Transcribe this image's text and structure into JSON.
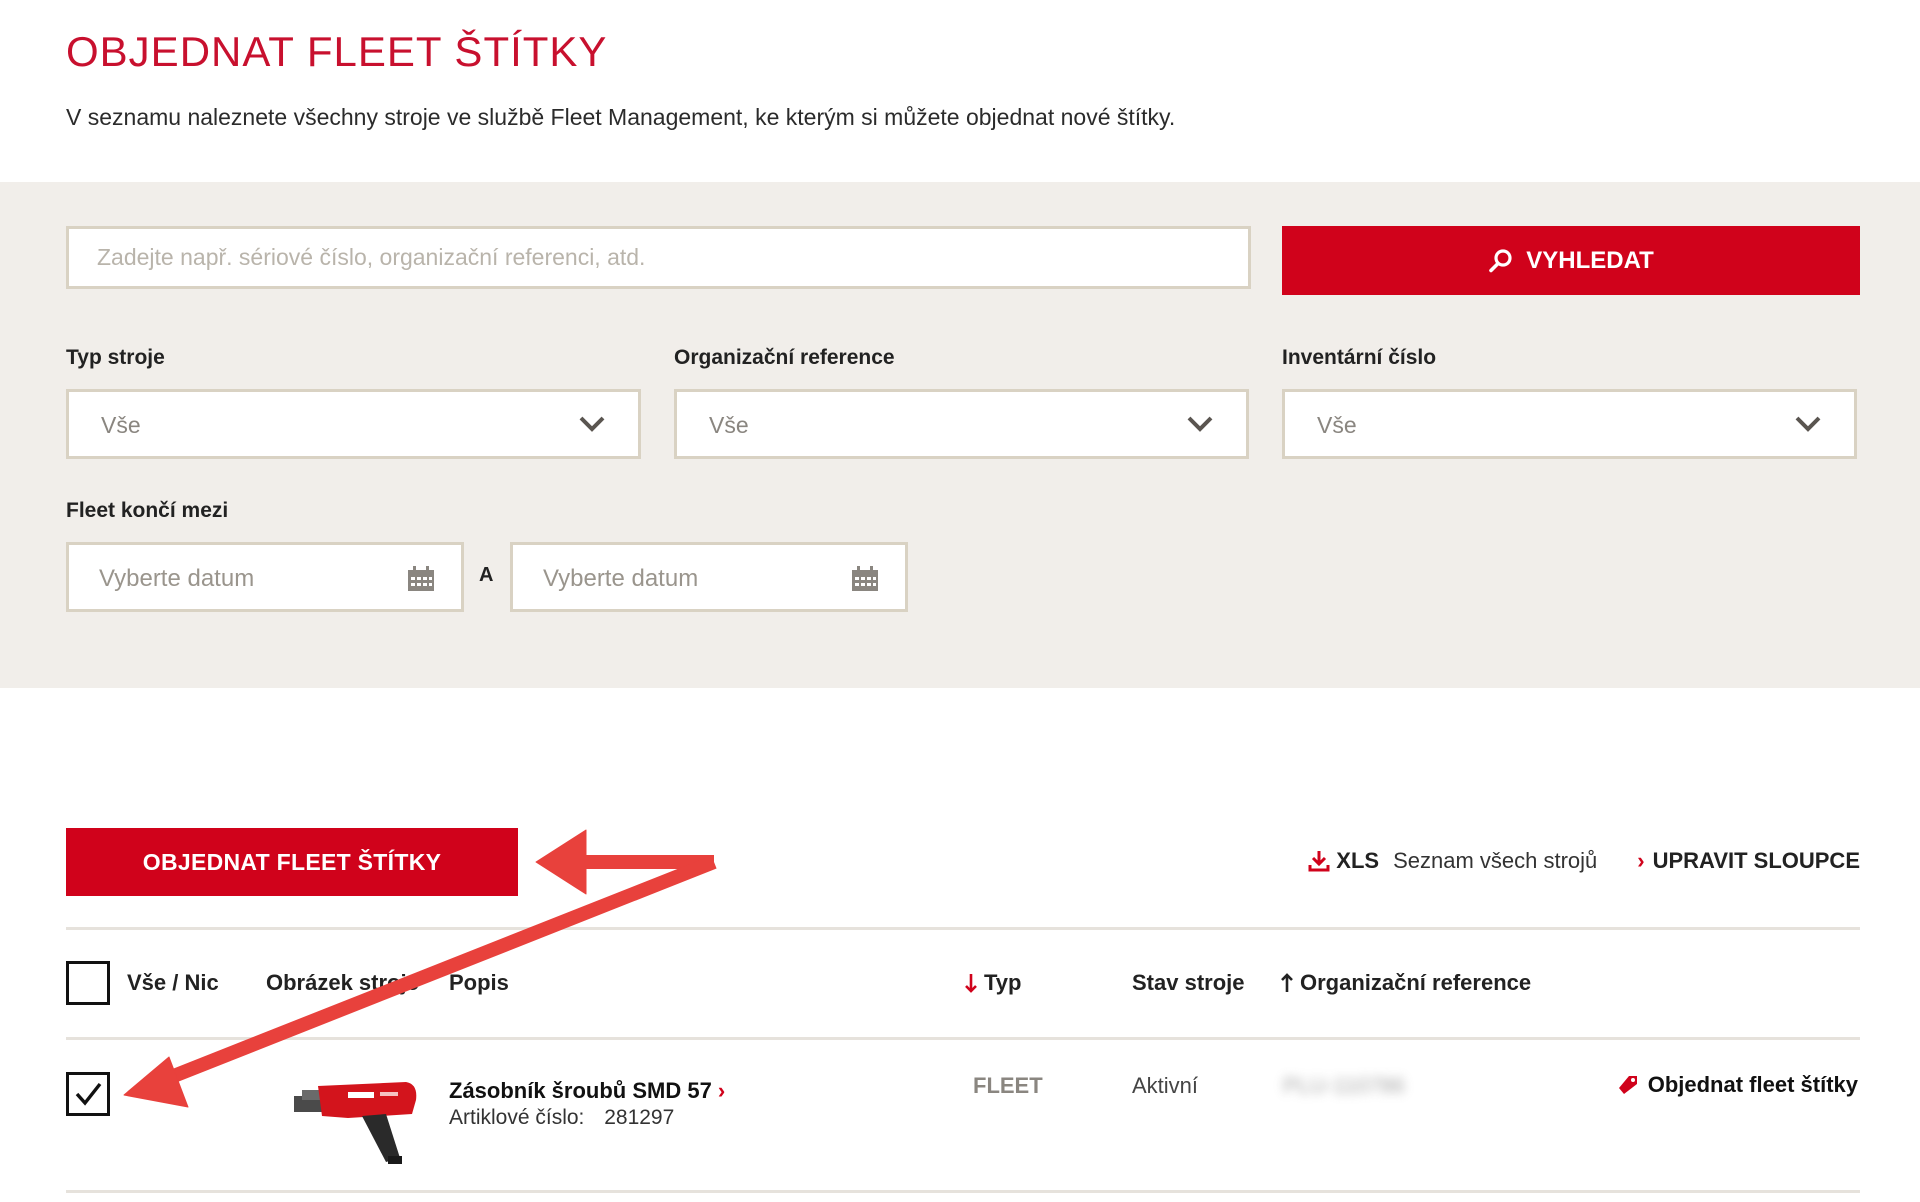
{
  "page": {
    "title": "OBJEDNAT FLEET ŠTÍTKY",
    "intro": "V seznamu naleznete všechny stroje ve službě Fleet Management, ke kterým si můžete objednat nové štítky."
  },
  "search": {
    "placeholder": "Zadejte např. sériové číslo, organizační referenci, atd.",
    "button_label": "VYHLEDAT"
  },
  "filters": {
    "machine_type": {
      "label": "Typ stroje",
      "value": "Vše"
    },
    "org_reference": {
      "label": "Organizační reference",
      "value": "Vše"
    },
    "inventory_number": {
      "label": "Inventární číslo",
      "value": "Vše"
    },
    "fleet_ends": {
      "label": "Fleet končí mezi",
      "from_placeholder": "Vyberte datum",
      "separator": "A",
      "to_placeholder": "Vyberte datum"
    }
  },
  "toolbar": {
    "order_button": "OBJEDNAT FLEET ŠTÍTKY",
    "xls_label": "XLS",
    "xls_description": "Seznam všech strojů",
    "edit_columns": "UPRAVIT SLOUPCE"
  },
  "table": {
    "headers": {
      "select_all": "Vše / Nic",
      "image": "Obrázek stroje",
      "description": "Popis",
      "type": "Typ",
      "status": "Stav stroje",
      "org_reference": "Organizační reference"
    },
    "rows": [
      {
        "checked": true,
        "name": "Zásobník šroubů SMD 57",
        "article_label": "Artiklové číslo:",
        "article_number": "281297",
        "type": "FLEET",
        "status": "Aktivní",
        "org_reference": "PLU-110786",
        "action": "Objednat fleet štítky"
      }
    ]
  },
  "colors": {
    "brand_red": "#d0021b",
    "panel_bg": "#f1eeea",
    "input_border": "#d9d2c3",
    "annotation_arrow": "#e8413c"
  },
  "icons": {
    "search_button": "search-icon",
    "select": "chevron-down-icon",
    "date": "calendar-icon",
    "xls": "download-icon",
    "row_action": "tag-icon"
  }
}
